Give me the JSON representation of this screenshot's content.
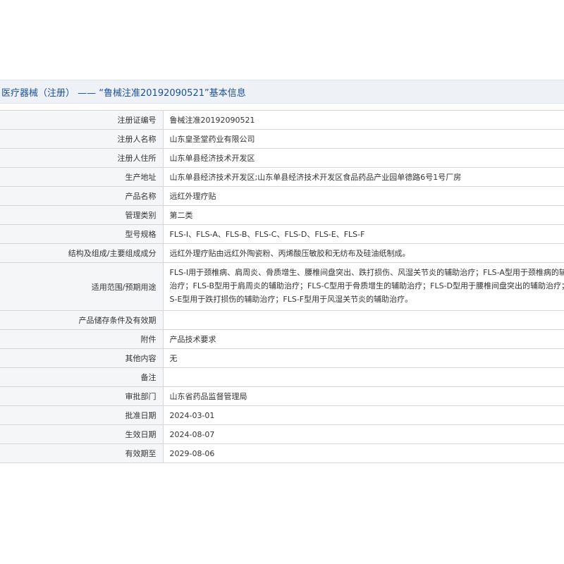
{
  "page_title": "医疗器械（注册） —— “鲁械注准20192090521”基本信息",
  "rows": [
    {
      "label": "注册证编号",
      "value": "鲁械注准20192090521"
    },
    {
      "label": "注册人名称",
      "value": "山东皇圣堂药业有限公司"
    },
    {
      "label": "注册人住所",
      "value": "山东单县经济技术开发区"
    },
    {
      "label": "生产地址",
      "value": "山东单县经济技术开发区;山东单县经济技术开发区食品药品产业园单德路6号1号厂房"
    },
    {
      "label": "产品名称",
      "value": "远红外理疗贴"
    },
    {
      "label": "管理类别",
      "value": "第二类"
    },
    {
      "label": "型号规格",
      "value": "FLS-I、FLS-A、FLS-B、FLS-C、FLS-D、FLS-E、FLS-F"
    },
    {
      "label": "结构及组成/主要组成成分",
      "value": "远红外理疗贴由远红外陶瓷粉、丙烯酸压敏胶和无纺布及硅油纸制成。"
    },
    {
      "label": "适用范围/预期用途",
      "value": "FLS-I用于颈椎病、肩周炎、骨质增生、腰椎间盘突出、跌打损伤、风湿关节炎的辅助治疗；FLS-A型用于颈椎病的辅助治疗；FLS-B型用于肩周炎的辅助治疗；FLS-C型用于骨质增生的辅助治疗；FLS-D型用于腰椎间盘突出的辅助治疗；FLS-E型用于跌打损伤的辅助治疗；FLS-F型用于风湿关节炎的辅助治疗。"
    },
    {
      "label": "产品储存条件及有效期",
      "value": ""
    },
    {
      "label": "附件",
      "value": "产品技术要求"
    },
    {
      "label": "其他内容",
      "value": "无"
    },
    {
      "label": "备注",
      "value": ""
    },
    {
      "label": "审批部门",
      "value": "山东省药品监督管理局"
    },
    {
      "label": "批准日期",
      "value": "2024-03-01"
    },
    {
      "label": "生效日期",
      "value": "2024-08-07"
    },
    {
      "label": "有效期至",
      "value": "2029-08-06"
    }
  ]
}
